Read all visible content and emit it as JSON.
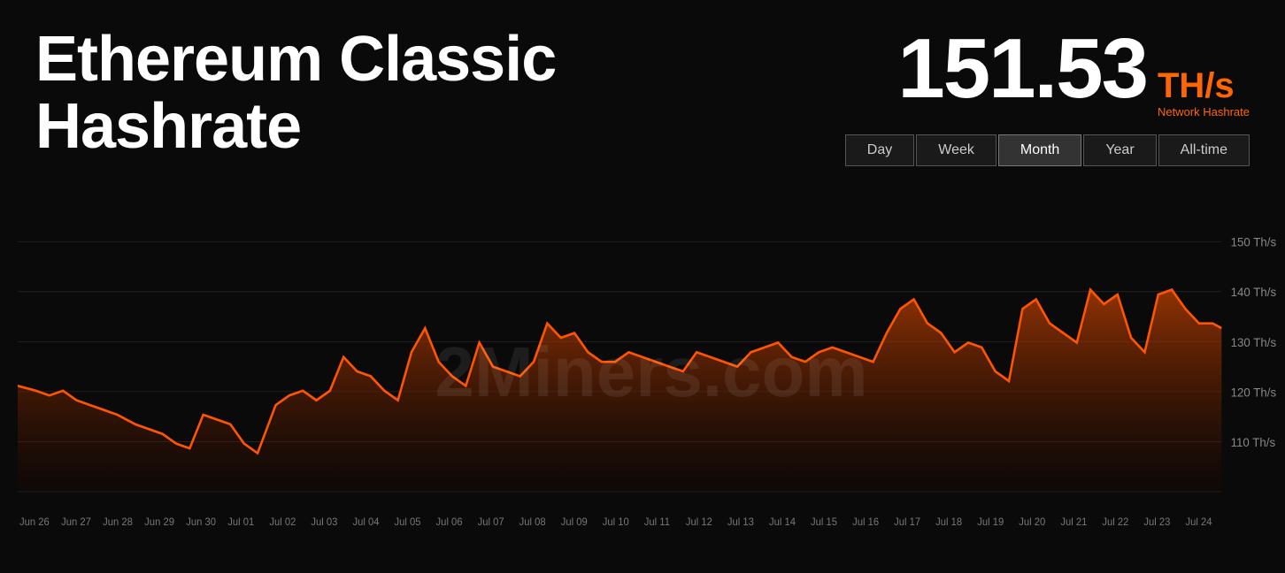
{
  "header": {
    "title_line1": "Ethereum Classic",
    "title_line2": "Hashrate",
    "hashrate_value": "151.53",
    "hashrate_unit": "TH/s",
    "hashrate_label": "Network Hashrate"
  },
  "filters": {
    "items": [
      "Day",
      "Week",
      "Month",
      "Year",
      "All-time"
    ],
    "active": "Month"
  },
  "chart": {
    "y_labels": [
      "150 Th/s",
      "140 Th/s",
      "130 Th/s",
      "120 Th/s",
      "110 Th/s"
    ],
    "x_labels": [
      "Jun 26",
      "Jun 27",
      "Jun 28",
      "Jun 29",
      "Jun 30",
      "Jul 01",
      "Jul 02",
      "Jul 03",
      "Jul 04",
      "Jul 05",
      "Jul 06",
      "Jul 07",
      "Jul 08",
      "Jul 09",
      "Jul 10",
      "Jul 11",
      "Jul 12",
      "Jul 13",
      "Jul 14",
      "Jul 15",
      "Jul 16",
      "Jul 17",
      "Jul 18",
      "Jul 19",
      "Jul 20",
      "Jul 21",
      "Jul 22",
      "Jul 23",
      "Jul 24"
    ]
  },
  "watermark": "2Miners.com"
}
